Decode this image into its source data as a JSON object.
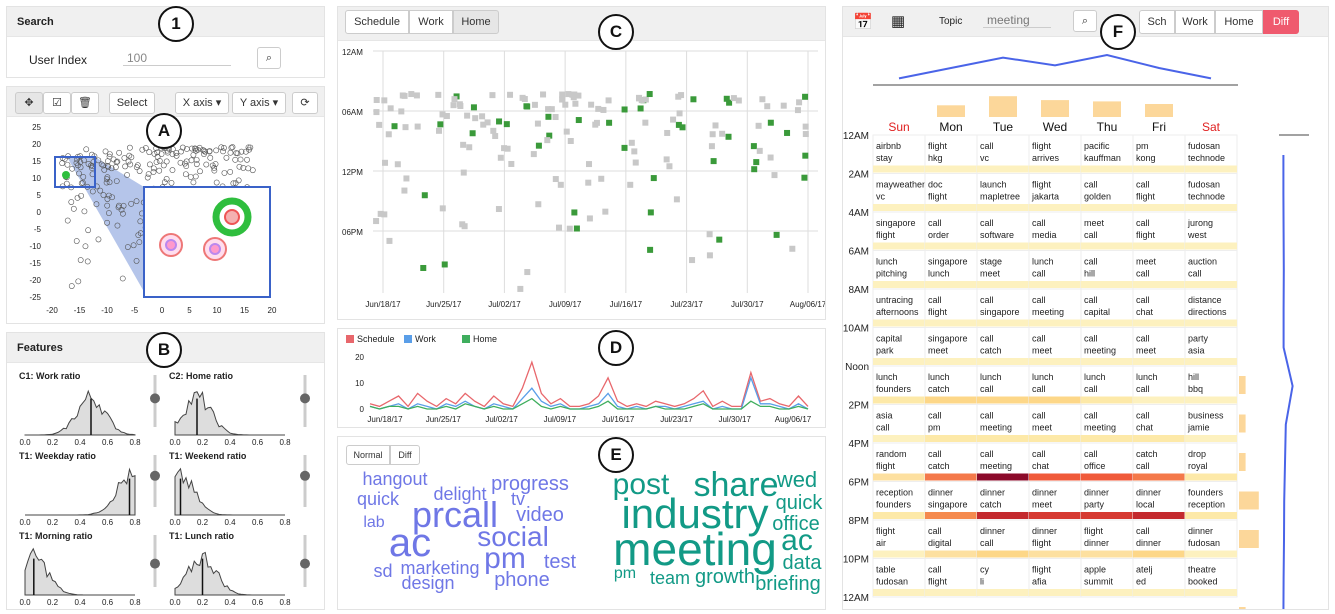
{
  "callouts": {
    "one": "1",
    "a": "A",
    "b": "B",
    "c": "C",
    "d": "D",
    "e": "E",
    "f": "F"
  },
  "search": {
    "title": "Search",
    "user_label": "User Index",
    "user_value": "100"
  },
  "toolbar": {
    "select": "Select",
    "xaxis": "X axis ▾",
    "yaxis": "Y axis ▾"
  },
  "scatter": {
    "yticks": [
      "25",
      "20",
      "15",
      "10",
      "5",
      "0",
      "-5",
      "-10",
      "-15",
      "-20",
      "-25"
    ],
    "xticks": [
      "-20",
      "-15",
      "-10",
      "-5",
      "0",
      "5",
      "10",
      "15",
      "20"
    ]
  },
  "features": {
    "title": "Features",
    "xticks": [
      "0.0",
      "0.2",
      "0.4",
      "0.6",
      "0.8"
    ],
    "items": [
      {
        "label": "C1: Work ratio",
        "mark": 0.6,
        "slider": 0.45
      },
      {
        "label": "C2: Home ratio",
        "mark": 0.2,
        "slider": 0.45
      },
      {
        "label": "T1: Weekday ratio",
        "mark": 0.95,
        "slider": 0.4
      },
      {
        "label": "T1: Weekend ratio",
        "mark": 0.05,
        "slider": 0.4
      },
      {
        "label": "T1: Morning ratio",
        "mark": 0.08,
        "slider": 0.55
      },
      {
        "label": "T1: Lunch ratio",
        "mark": 0.25,
        "slider": 0.55
      }
    ]
  },
  "timeline": {
    "buttons": [
      "Schedule",
      "Work",
      "Home"
    ],
    "yticks": [
      "12AM",
      "06AM",
      "12PM",
      "06PM"
    ],
    "xticks": [
      "Jun/18/17",
      "Jun/25/17",
      "Jul/02/17",
      "Jul/09/17",
      "Jul/16/17",
      "Jul/23/17",
      "Jul/30/17",
      "Aug/06/17"
    ]
  },
  "chart_data": {
    "type": "line",
    "categories": [
      "Jun/18/17",
      "Jun/25/17",
      "Jul/02/17",
      "Jul/09/17",
      "Jul/16/17",
      "Jul/23/17",
      "Jul/30/17",
      "Aug/06/17"
    ],
    "ylim": [
      0,
      20
    ],
    "yticks": [
      "20",
      "10",
      "0"
    ],
    "series": [
      {
        "name": "Schedule",
        "color": "#e8676c",
        "values": [
          2,
          1,
          3,
          5,
          1,
          6,
          3,
          1,
          4,
          2,
          6,
          3,
          1,
          5,
          2,
          1,
          8,
          18,
          6,
          2,
          4,
          1,
          1,
          2,
          5,
          12,
          3,
          1,
          2,
          1,
          3,
          2,
          1,
          2,
          4,
          7,
          1,
          3,
          1,
          1,
          14,
          3,
          4,
          2,
          1,
          5,
          1
        ]
      },
      {
        "name": "Work",
        "color": "#5a9ee8",
        "values": [
          1,
          0,
          1,
          2,
          0,
          2,
          1,
          0,
          2,
          1,
          3,
          1,
          0,
          2,
          1,
          0,
          4,
          8,
          3,
          1,
          2,
          0,
          0,
          1,
          2,
          6,
          1,
          0,
          1,
          0,
          1,
          1,
          0,
          1,
          2,
          3,
          0,
          1,
          0,
          0,
          12,
          2,
          2,
          1,
          0,
          2,
          0
        ]
      },
      {
        "name": "Home",
        "color": "#3fae5e",
        "values": [
          1,
          0,
          1,
          1,
          0,
          1,
          0,
          0,
          1,
          0,
          2,
          1,
          0,
          1,
          0,
          0,
          2,
          4,
          1,
          0,
          1,
          0,
          0,
          0,
          1,
          3,
          0,
          0,
          0,
          0,
          1,
          0,
          0,
          0,
          1,
          2,
          0,
          0,
          0,
          0,
          3,
          1,
          1,
          0,
          0,
          1,
          0
        ]
      }
    ]
  },
  "words": {
    "normal": "Normal",
    "diff": "Diff",
    "left": [
      {
        "t": "hangout",
        "x": 395,
        "y": 485,
        "s": 18
      },
      {
        "t": "progress",
        "x": 530,
        "y": 490,
        "s": 20
      },
      {
        "t": "quick",
        "x": 378,
        "y": 505,
        "s": 18
      },
      {
        "t": "delight",
        "x": 460,
        "y": 500,
        "s": 18
      },
      {
        "t": "tv",
        "x": 518,
        "y": 505,
        "s": 18
      },
      {
        "t": "lab",
        "x": 374,
        "y": 527,
        "s": 16
      },
      {
        "t": "prcall",
        "x": 455,
        "y": 527,
        "s": 36
      },
      {
        "t": "video",
        "x": 540,
        "y": 521,
        "s": 20
      },
      {
        "t": "ac",
        "x": 410,
        "y": 556,
        "s": 40
      },
      {
        "t": "social",
        "x": 513,
        "y": 546,
        "s": 28
      },
      {
        "t": "pm",
        "x": 505,
        "y": 568,
        "s": 30
      },
      {
        "t": "test",
        "x": 560,
        "y": 568,
        "s": 20
      },
      {
        "t": "sd",
        "x": 383,
        "y": 577,
        "s": 18
      },
      {
        "t": "marketing",
        "x": 440,
        "y": 574,
        "s": 18
      },
      {
        "t": "phone",
        "x": 522,
        "y": 586,
        "s": 20
      },
      {
        "t": "design",
        "x": 428,
        "y": 589,
        "s": 18
      }
    ],
    "right": [
      {
        "t": "post",
        "x": 641,
        "y": 494,
        "s": 30
      },
      {
        "t": "share",
        "x": 736,
        "y": 496,
        "s": 34
      },
      {
        "t": "wed",
        "x": 797,
        "y": 487,
        "s": 22
      },
      {
        "t": "industry",
        "x": 695,
        "y": 528,
        "s": 42
      },
      {
        "t": "quick",
        "x": 799,
        "y": 509,
        "s": 20
      },
      {
        "t": "office",
        "x": 796,
        "y": 530,
        "s": 20
      },
      {
        "t": "meeting",
        "x": 695,
        "y": 565,
        "s": 46
      },
      {
        "t": "ac",
        "x": 797,
        "y": 550,
        "s": 30
      },
      {
        "t": "data",
        "x": 802,
        "y": 569,
        "s": 20
      },
      {
        "t": "pm",
        "x": 625,
        "y": 578,
        "s": 16
      },
      {
        "t": "team",
        "x": 670,
        "y": 584,
        "s": 18
      },
      {
        "t": "growth",
        "x": 725,
        "y": 583,
        "s": 20
      },
      {
        "t": "briefing",
        "x": 788,
        "y": 590,
        "s": 20
      }
    ]
  },
  "calendar": {
    "topic_label": "Topic",
    "topic_value": "meeting",
    "buttons": [
      "Sch",
      "Work",
      "Home",
      "Diff"
    ],
    "days": [
      "Sun",
      "Mon",
      "Tue",
      "Wed",
      "Thu",
      "Fri",
      "Sat"
    ],
    "day_bars": [
      0,
      0.45,
      0.8,
      0.65,
      0.6,
      0.5,
      0
    ],
    "day_line": [
      0.1,
      0.5,
      0.9,
      0.6,
      1.0,
      0.5,
      0.1
    ],
    "hours": [
      "12AM",
      "2AM",
      "4AM",
      "6AM",
      "8AM",
      "10AM",
      "Noon",
      "2PM",
      "4PM",
      "6PM",
      "8PM",
      "10PM",
      "12AM"
    ],
    "rows": [
      [
        "airbnb|stay",
        "flight|hkg",
        "call|vc",
        "flight|arrives",
        "pacific|kauffman",
        "pm|kong",
        "fudosan|technode"
      ],
      [
        "mayweather|vc",
        "doc|flight",
        "launch|mapletree",
        "flight|jakarta",
        "call|golden",
        "call|flight",
        "fudosan|technode"
      ],
      [
        "singapore|flight",
        "call|order",
        "call|software",
        "call|media",
        "meet|call",
        "call|flight",
        "jurong|west"
      ],
      [
        "lunch|pitching",
        "singapore|lunch",
        "stage|meet",
        "lunch|call",
        "call|hill",
        "meet|call",
        "auction|call"
      ],
      [
        "untracing|afternoons",
        "call|flight",
        "call|singapore",
        "call|meeting",
        "call|capital",
        "call|chat",
        "distance|directions"
      ],
      [
        "capital|park",
        "singapore|meet",
        "call|catch",
        "call|meet",
        "call|meeting",
        "call|meet",
        "party|asia"
      ],
      [
        "lunch|founders",
        "lunch|catch",
        "lunch|call",
        "lunch|call",
        "lunch|call",
        "lunch|call",
        "hill|bbq"
      ],
      [
        "asia|call",
        "call|pm",
        "call|meeting",
        "call|meet",
        "call|meeting",
        "call|chat",
        "business|jamie"
      ],
      [
        "random|flight",
        "call|catch",
        "call|meeting",
        "call|chat",
        "call|office",
        "catch|call",
        "drop|royal"
      ],
      [
        "reception|founders",
        "dinner|singapore",
        "dinner|catch",
        "dinner|meet",
        "dinner|party",
        "dinner|local",
        "founders|reception"
      ],
      [
        "flight|air",
        "call|digital",
        "dinner|call",
        "dinner|flight",
        "flight|dinner",
        "call|dinner",
        "dinner|fudosan"
      ],
      [
        "table|fudosan",
        "call|flight",
        "cy|li",
        "flight|afia",
        "apple|summit",
        "atelj|ed",
        "theatre|booked"
      ]
    ],
    "strip_colors": [
      [
        "#fdf1bf",
        "#fdf1bf",
        "#fdf1bf",
        "#fdf1bf",
        "#fdf1bf",
        "#fdf1bf",
        "#fdf1bf"
      ],
      [
        "#fdf1bf",
        "#fdf1bf",
        "#fdf1bf",
        "#fdf1bf",
        "#fdf1bf",
        "#fdf1bf",
        "#fdf1bf"
      ],
      [
        "#fdf1bf",
        "#fdf1bf",
        "#fdf1bf",
        "#fdf1bf",
        "#fdf1bf",
        "#fdf1bf",
        "#fdf1bf"
      ],
      [
        "#fdf1bf",
        "#fdf1bf",
        "#fdf1bf",
        "#fdf1bf",
        "#fdf1bf",
        "#fdf1bf",
        "#fdf1bf"
      ],
      [
        "#fdf1bf",
        "#fdf1bf",
        "#fdf1bf",
        "#fdf1bf",
        "#fdf1bf",
        "#fdf1bf",
        "#fdf1bf"
      ],
      [
        "#fdf1bf",
        "#fdf1bf",
        "#fdf1bf",
        "#fdf1bf",
        "#fdf1bf",
        "#fdf1bf",
        "#fdf1bf"
      ],
      [
        "#fde9a8",
        "#fdd788",
        "#fdd788",
        "#fdd788",
        "#fde9a8",
        "#fdf1bf",
        "#fdf1bf"
      ],
      [
        "#fdf1bf",
        "#fde9a8",
        "#fde9a8",
        "#fde9a8",
        "#fde9a8",
        "#fde9a8",
        "#fdf1bf"
      ],
      [
        "#fde0a0",
        "#f4794a",
        "#8b0a2a",
        "#f05a3a",
        "#f05a3a",
        "#f4794a",
        "#fde9a8"
      ],
      [
        "#fde9a8",
        "#f58a4e",
        "#c42a2e",
        "#d63a32",
        "#d63a32",
        "#c42a2e",
        "#fde9a8"
      ],
      [
        "#fdf1bf",
        "#fde0a0",
        "#fdd788",
        "#fde0a0",
        "#fde0a0",
        "#fdd788",
        "#fdf1bf"
      ],
      [
        "#fdf1bf",
        "#fdf1bf",
        "#fdf1bf",
        "#fdf1bf",
        "#fdf1bf",
        "#fdf1bf",
        "#fdf1bf"
      ]
    ],
    "side_bars": [
      0,
      0,
      0,
      0,
      0,
      0,
      0.3,
      0.3,
      0.3,
      0.9,
      0.9,
      0,
      0.3
    ],
    "side_line": [
      0.1,
      0.1,
      0.15,
      0.2,
      0.15,
      0.15,
      0.9,
      0.7,
      0.5,
      0.3,
      0.25,
      0.15,
      0.1
    ]
  }
}
